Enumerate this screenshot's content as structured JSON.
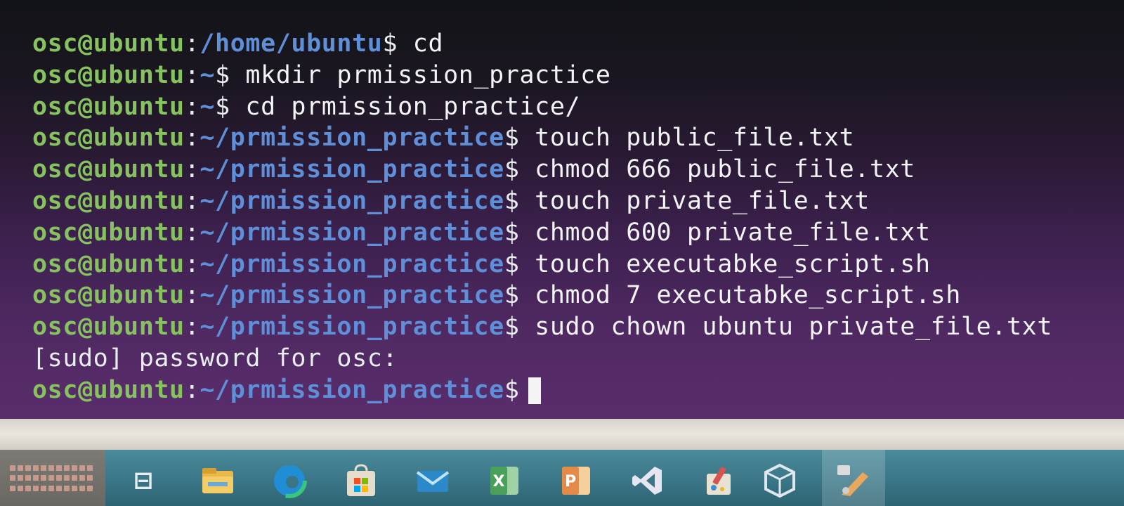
{
  "terminal": {
    "lines": [
      {
        "user": "osc@ubuntu",
        "colon": ":",
        "path": "/home/ubuntu",
        "dollar": "$",
        "command": " cd"
      },
      {
        "user": "osc@ubuntu",
        "colon": ":",
        "path": "~",
        "dollar": "$",
        "command": " mkdir prmission_practice"
      },
      {
        "user": "osc@ubuntu",
        "colon": ":",
        "path": "~",
        "dollar": "$",
        "command": " cd prmission_practice/"
      },
      {
        "user": "osc@ubuntu",
        "colon": ":",
        "path": "~/prmission_practice",
        "dollar": "$",
        "command": " touch public_file.txt"
      },
      {
        "user": "osc@ubuntu",
        "colon": ":",
        "path": "~/prmission_practice",
        "dollar": "$",
        "command": " chmod 666 public_file.txt"
      },
      {
        "user": "osc@ubuntu",
        "colon": ":",
        "path": "~/prmission_practice",
        "dollar": "$",
        "command": " touch private_file.txt"
      },
      {
        "user": "osc@ubuntu",
        "colon": ":",
        "path": "~/prmission_practice",
        "dollar": "$",
        "command": " chmod 600 private_file.txt"
      },
      {
        "user": "osc@ubuntu",
        "colon": ":",
        "path": "~/prmission_practice",
        "dollar": "$",
        "command": " touch executabke_script.sh"
      },
      {
        "user": "osc@ubuntu",
        "colon": ":",
        "path": "~/prmission_practice",
        "dollar": "$",
        "command": " chmod 7 executabke_script.sh"
      },
      {
        "user": "osc@ubuntu",
        "colon": ":",
        "path": "~/prmission_practice",
        "dollar": "$",
        "command": " sudo chown ubuntu private_file.txt"
      }
    ],
    "output_line": "[sudo] password for osc:",
    "final_prompt": {
      "user": "osc@ubuntu",
      "colon": ":",
      "path": "~/prmission_practice",
      "dollar": "$"
    }
  },
  "colors": {
    "prompt_user": "#86c35f",
    "prompt_path": "#5f8fd8",
    "terminal_bg_bottom": "#5a2d6c",
    "taskbar": "#3a7687"
  },
  "taskbar": {
    "icons": [
      {
        "name": "task-view-icon",
        "glyph": "⊟"
      },
      {
        "name": "file-explorer-icon",
        "glyph": ""
      },
      {
        "name": "edge-browser-icon",
        "glyph": "e"
      },
      {
        "name": "microsoft-store-icon",
        "glyph": ""
      },
      {
        "name": "mail-icon",
        "glyph": "✉"
      },
      {
        "name": "excel-icon",
        "glyph": "X"
      },
      {
        "name": "powerpoint-icon",
        "glyph": "P"
      },
      {
        "name": "visual-studio-icon",
        "glyph": "⋈"
      },
      {
        "name": "paint-icon",
        "glyph": "✎"
      },
      {
        "name": "virtualbox-icon",
        "glyph": "⬡"
      },
      {
        "name": "snipping-tool-icon",
        "glyph": "✂"
      }
    ]
  }
}
